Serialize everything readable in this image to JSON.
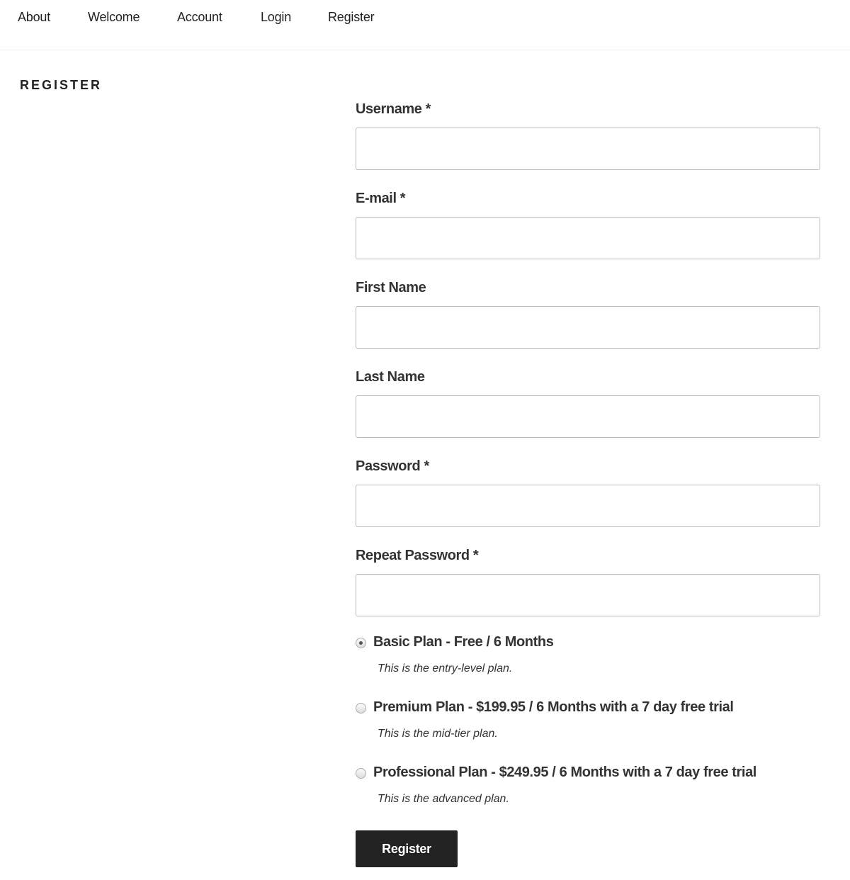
{
  "nav": {
    "items": [
      "About",
      "Welcome",
      "Account",
      "Login",
      "Register"
    ]
  },
  "page": {
    "title": "REGISTER"
  },
  "form": {
    "fields": [
      {
        "label": "Username *",
        "value": ""
      },
      {
        "label": "E-mail *",
        "value": ""
      },
      {
        "label": "First Name",
        "value": ""
      },
      {
        "label": "Last Name",
        "value": ""
      },
      {
        "label": "Password *",
        "value": ""
      },
      {
        "label": "Repeat Password *",
        "value": ""
      }
    ],
    "plans": [
      {
        "label": "Basic Plan - Free / 6 Months",
        "description": "This is the entry-level plan.",
        "selected": true
      },
      {
        "label": "Premium Plan - $199.95 / 6 Months with a 7 day free trial",
        "description": "This is the mid-tier plan.",
        "selected": false
      },
      {
        "label": "Professional Plan - $249.95 / 6 Months with a 7 day free trial",
        "description": "This is the advanced plan.",
        "selected": false
      }
    ],
    "submit_label": "Register"
  }
}
